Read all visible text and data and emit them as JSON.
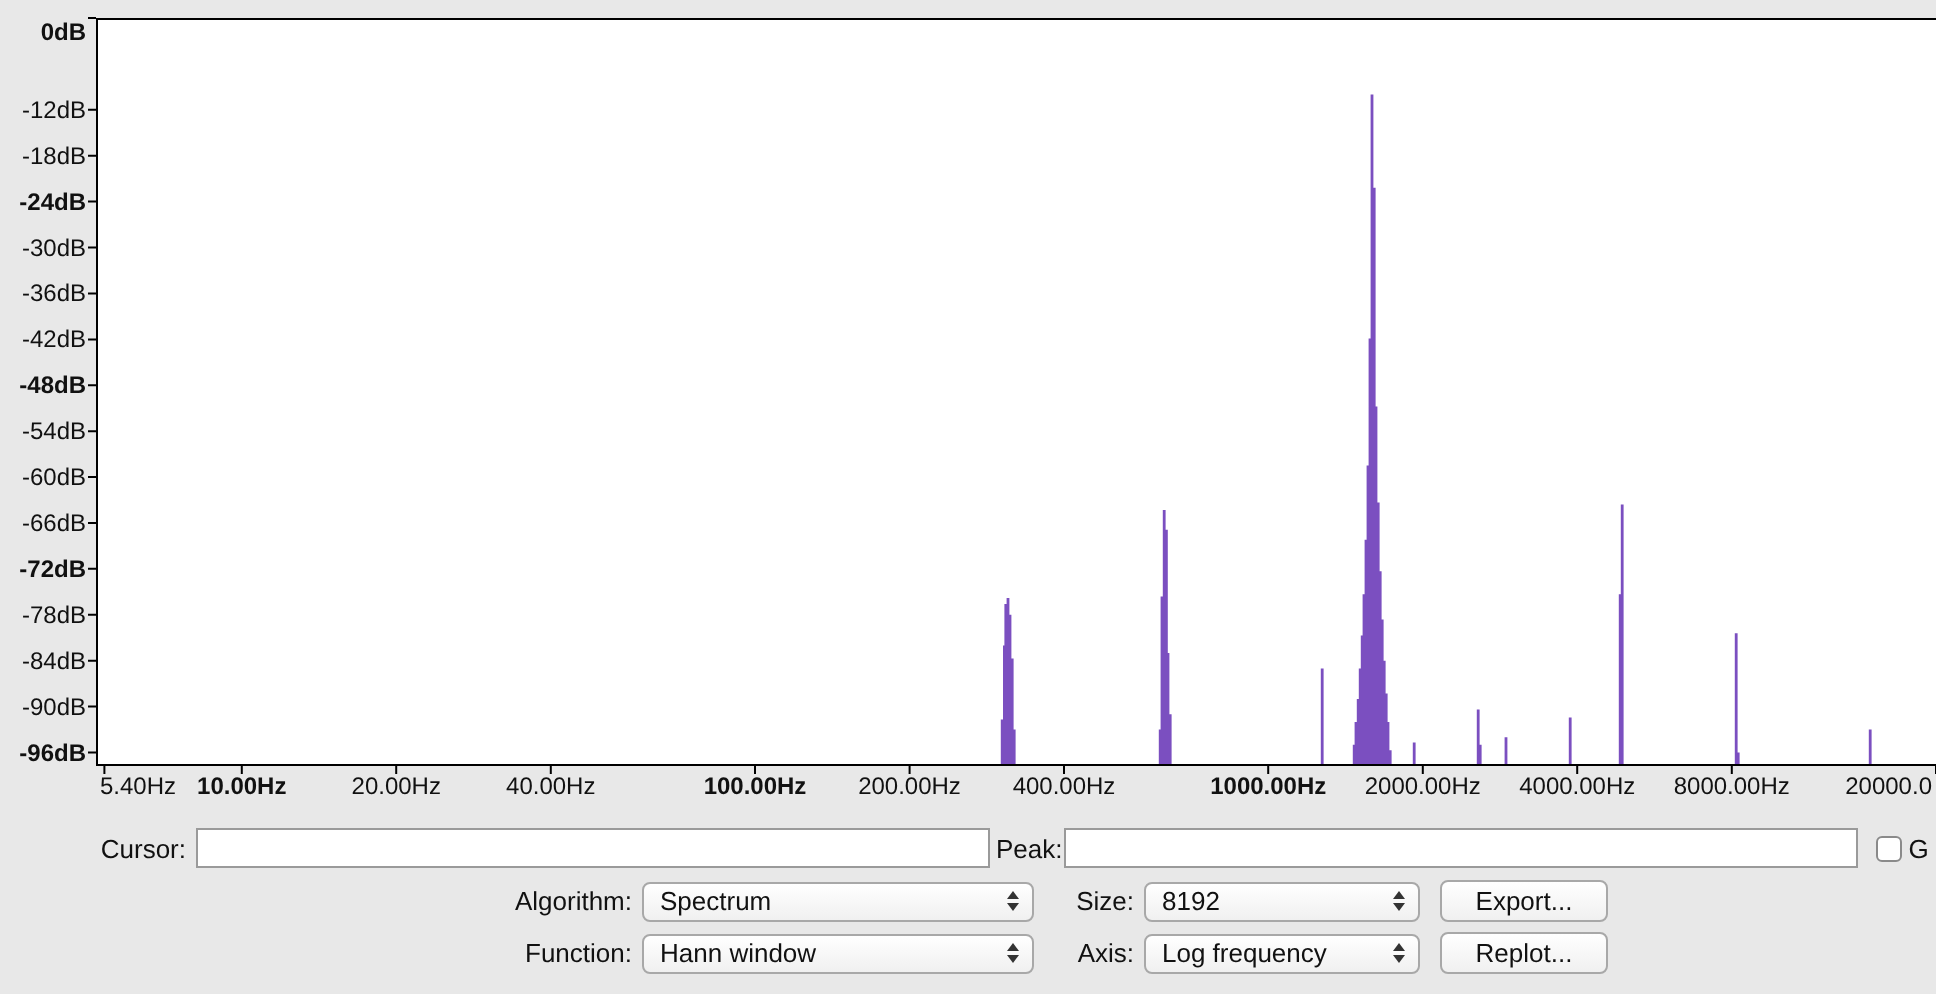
{
  "spectrum": {
    "y_labels": [
      {
        "label": "0dB",
        "major": true
      },
      {
        "label": "-12dB",
        "major": false
      },
      {
        "label": "-18dB",
        "major": false
      },
      {
        "label": "-24dB",
        "major": true
      },
      {
        "label": "-30dB",
        "major": false
      },
      {
        "label": "-36dB",
        "major": false
      },
      {
        "label": "-42dB",
        "major": false
      },
      {
        "label": "-48dB",
        "major": true
      },
      {
        "label": "-54dB",
        "major": false
      },
      {
        "label": "-60dB",
        "major": false
      },
      {
        "label": "-66dB",
        "major": false
      },
      {
        "label": "-72dB",
        "major": true
      },
      {
        "label": "-78dB",
        "major": false
      },
      {
        "label": "-84dB",
        "major": false
      },
      {
        "label": "-90dB",
        "major": false
      },
      {
        "label": "-96dB",
        "major": true
      }
    ],
    "x_labels": [
      {
        "label": "5.40Hz",
        "major": false
      },
      {
        "label": "10.00Hz",
        "major": true
      },
      {
        "label": "20.00Hz",
        "major": false
      },
      {
        "label": "40.00Hz",
        "major": false
      },
      {
        "label": "100.00Hz",
        "major": true
      },
      {
        "label": "200.00Hz",
        "major": false
      },
      {
        "label": "400.00Hz",
        "major": false
      },
      {
        "label": "1000.00Hz",
        "major": true
      },
      {
        "label": "2000.00Hz",
        "major": false
      },
      {
        "label": "4000.00Hz",
        "major": false
      },
      {
        "label": "8000.00Hz",
        "major": false
      },
      {
        "label": "20000.0",
        "major": false
      }
    ]
  },
  "cursor": {
    "label": "Cursor:"
  },
  "peak": {
    "label": "Peak:"
  },
  "grid": {
    "label": "G",
    "checked": false
  },
  "algorithm": {
    "label": "Algorithm:",
    "value": "Spectrum"
  },
  "size": {
    "label": "Size:",
    "value": "8192"
  },
  "export_button": "Export...",
  "function": {
    "label": "Function:",
    "value": "Hann window"
  },
  "axis": {
    "label": "Axis:",
    "value": "Log frequency"
  },
  "replot_button": "Replot..."
}
